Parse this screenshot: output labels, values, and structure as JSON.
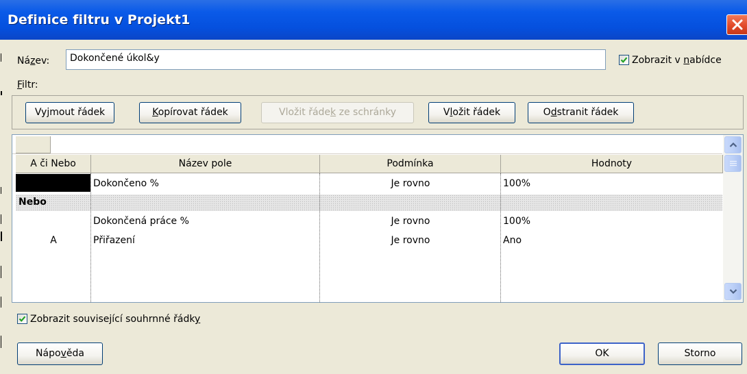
{
  "window": {
    "title": "Definice filtru v Projekt1"
  },
  "name_row": {
    "label_pre": "Ná",
    "label_u": "z",
    "label_post": "ev:",
    "value": "Dokončené úkol&y",
    "show_in_menu": {
      "checked": true,
      "label_pre": "Zobrazit v ",
      "label_u": "n",
      "label_post": "abídce"
    }
  },
  "filter_label": {
    "u": "F",
    "post": "iltr:"
  },
  "toolbar": {
    "cut_row": {
      "pre": "Vy",
      "u": "j",
      "post": "mout řádek"
    },
    "copy_row": {
      "pre": "",
      "u": "K",
      "post": "opírovat řádek"
    },
    "paste_row": {
      "pre": "Vložit řáde",
      "u": "k",
      "post": " ze schránky",
      "disabled": true
    },
    "insert_row": {
      "pre": "V",
      "u": "l",
      "post": "ožit řádek"
    },
    "delete_row": {
      "pre": "O",
      "u": "d",
      "post": "stranit řádek"
    }
  },
  "grid": {
    "columns": [
      "A či Nebo",
      "Název pole",
      "Podmínka",
      "Hodnoty"
    ],
    "rows": [
      {
        "andor": "",
        "field": "Dokončeno %",
        "condition": "Je rovno",
        "value": "100%",
        "selected": true
      },
      {
        "andor": "Nebo",
        "field": "",
        "condition": "",
        "value": "",
        "group": true
      },
      {
        "andor": "",
        "field": "Dokončená práce %",
        "condition": "Je rovno",
        "value": "100%"
      },
      {
        "andor": "A",
        "field": "Přiřazení",
        "condition": "Je rovno",
        "value": "Ano"
      }
    ]
  },
  "summary_rows": {
    "checked": true,
    "pre": "Zobrazit související souhrnné řádk",
    "u": "y",
    "post": ""
  },
  "buttons": {
    "help": {
      "pre": "Nápo",
      "u": "v",
      "post": "ěda"
    },
    "ok": "OK",
    "cancel": "Storno"
  },
  "colors": {
    "title_bar": "#0a5ae8",
    "dialog_bg": "#ece9d8",
    "close_button": "#e24a2a",
    "checkmark": "#21a121",
    "selection": "#000000"
  },
  "icons": {
    "close": "close-icon",
    "check": "checkmark-icon",
    "scroll_up": "chevron-up-icon",
    "scroll_down": "chevron-down-icon",
    "scroll_thumb": "grip-icon"
  }
}
